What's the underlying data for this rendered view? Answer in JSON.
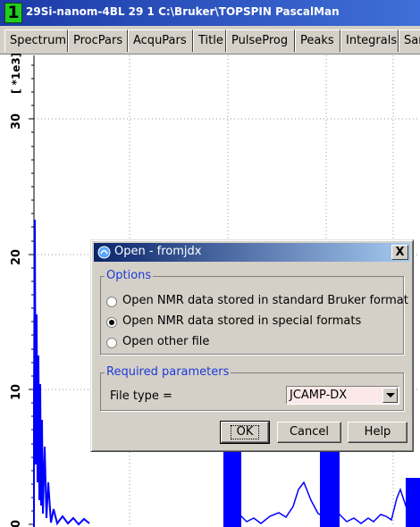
{
  "window": {
    "number": "1",
    "title": "29Si-nanom-4BL  29  1  C:\\Bruker\\TOPSPIN  PascalMan"
  },
  "tabs": [
    {
      "label": "Spectrum"
    },
    {
      "label": "ProcPars"
    },
    {
      "label": "AcquPars"
    },
    {
      "label": "Title"
    },
    {
      "label": "PulseProg"
    },
    {
      "label": "Peaks"
    },
    {
      "label": "Integrals"
    },
    {
      "label": "Sam"
    }
  ],
  "spectrum": {
    "y_axis_unit": "[ *1e3]",
    "y_ticks": [
      "30",
      "20",
      "10",
      "0"
    ],
    "trace_color": "#0000ff"
  },
  "dialog": {
    "title": "Open - fromjdx",
    "close_label": "X",
    "options_legend": "Options",
    "options": [
      {
        "label": "Open NMR data stored in standard Bruker format",
        "selected": false
      },
      {
        "label": "Open NMR data stored in special formats",
        "selected": true
      },
      {
        "label": "Open other file",
        "selected": false
      }
    ],
    "required_legend": "Required parameters",
    "file_type_label": "File type =",
    "file_type_value": "JCAMP-DX",
    "buttons": {
      "ok": "OK",
      "cancel": "Cancel",
      "help": "Help"
    }
  },
  "colors": {
    "title_bar": "#1c3aa8",
    "dialog_title": "#0a246a",
    "legend_text": "#1d3ad6",
    "select_bg": "#fbe9ea"
  }
}
